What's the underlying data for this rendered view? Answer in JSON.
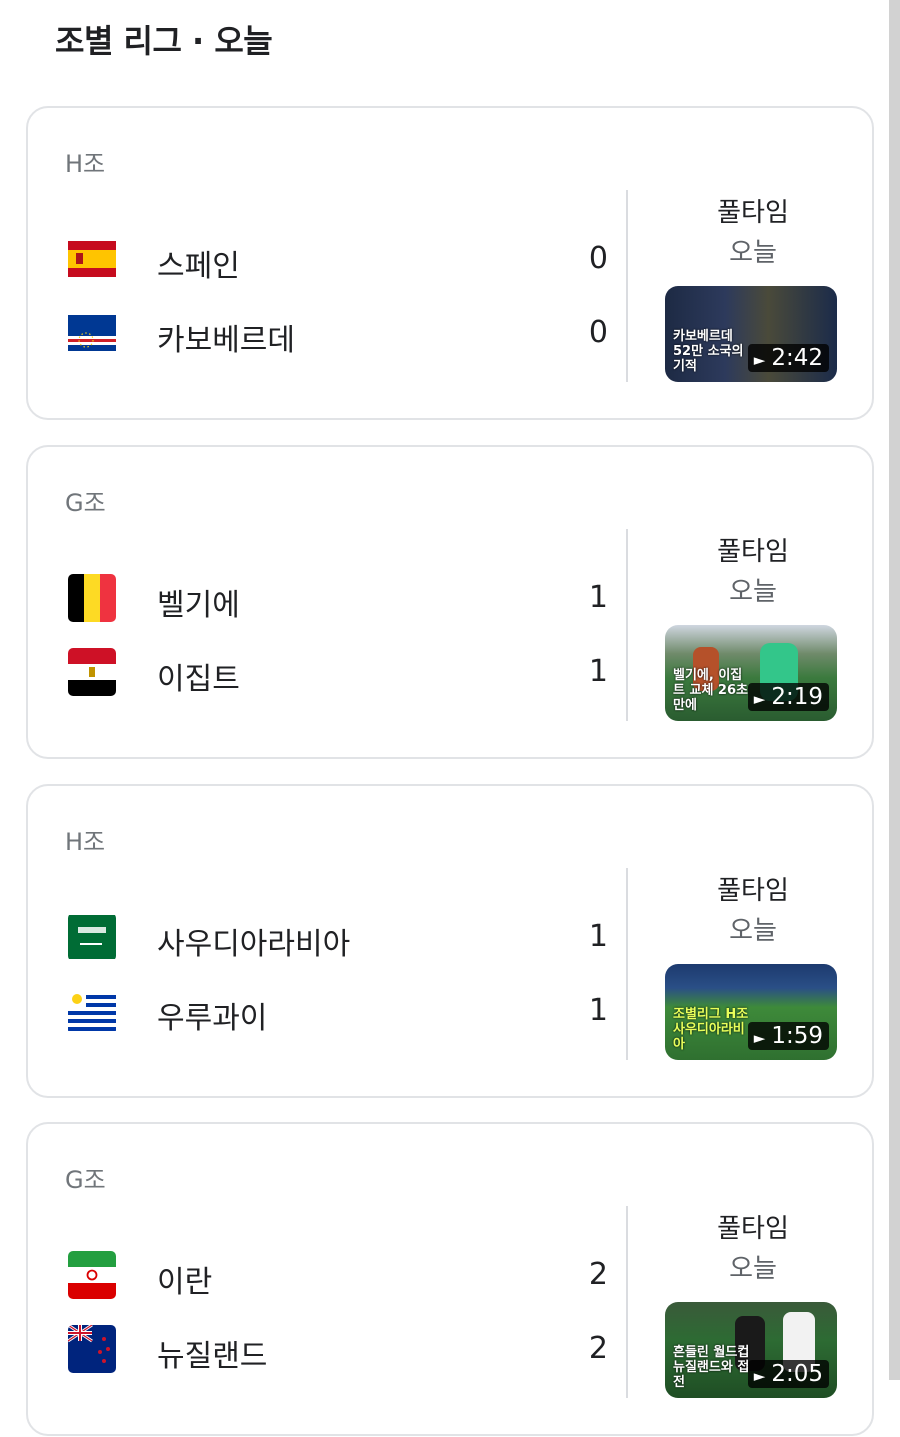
{
  "header": {
    "title": "조별 리그 · 오늘"
  },
  "matches": [
    {
      "group": "H조",
      "teams": [
        {
          "name": "스페인",
          "score": "0",
          "flag": "spain-flag"
        },
        {
          "name": "카보베르데",
          "score": "0",
          "flag": "cape-verde-flag"
        }
      ],
      "status": "풀타임",
      "day": "오늘",
      "video": {
        "duration": "2:42",
        "caption": "카보베르데 52만 소국의 기적"
      }
    },
    {
      "group": "G조",
      "teams": [
        {
          "name": "벨기에",
          "score": "1",
          "flag": "belgium-flag"
        },
        {
          "name": "이집트",
          "score": "1",
          "flag": "egypt-flag"
        }
      ],
      "status": "풀타임",
      "day": "오늘",
      "video": {
        "duration": "2:19",
        "caption": "벨기에, 이집트 교체 26초 만에"
      }
    },
    {
      "group": "H조",
      "teams": [
        {
          "name": "사우디아라비아",
          "score": "1",
          "flag": "saudi-arabia-flag"
        },
        {
          "name": "우루과이",
          "score": "1",
          "flag": "uruguay-flag"
        }
      ],
      "status": "풀타임",
      "day": "오늘",
      "video": {
        "duration": "1:59",
        "caption": "조별리그 H조 사우디아라비아"
      }
    },
    {
      "group": "G조",
      "teams": [
        {
          "name": "이란",
          "score": "2",
          "flag": "iran-flag"
        },
        {
          "name": "뉴질랜드",
          "score": "2",
          "flag": "new-zealand-flag"
        }
      ],
      "status": "풀타임",
      "day": "오늘",
      "video": {
        "duration": "2:05",
        "caption": "흔들린 월드컵 뉴질랜드와 접전"
      }
    }
  ],
  "colors": {
    "card_border": "#e1e3e6",
    "divider": "#dadce0",
    "muted_text": "#70757a"
  }
}
